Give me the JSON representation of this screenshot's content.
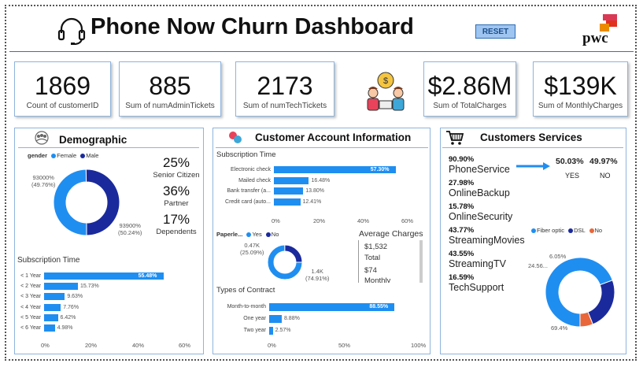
{
  "header": {
    "title": "Phone Now Churn Dashboard",
    "reset_label": "RESET",
    "logo_text": "pwc"
  },
  "kpis": [
    {
      "value": "1869",
      "label": "Count of customerID"
    },
    {
      "value": "885",
      "label": "Sum of numAdminTickets"
    },
    {
      "value": "2173",
      "label": "Sum of numTechTickets"
    },
    {
      "value": "$2.86M",
      "label": "Sum of TotalCharges"
    },
    {
      "value": "$139K",
      "label": "Sum of MonthlyCharges"
    }
  ],
  "demographic": {
    "title": "Demographic",
    "legend_title": "gender",
    "legend": [
      {
        "name": "Female",
        "color": "#1f8ef1"
      },
      {
        "name": "Male",
        "color": "#1a2a9c"
      }
    ],
    "donut_labels": {
      "left_top": "93000%",
      "left_bottom": "(49.76%)",
      "right_top": "93900%",
      "right_bottom": "(50.24%)"
    },
    "stats": [
      {
        "value": "25%",
        "label": "Senior Citizen"
      },
      {
        "value": "36%",
        "label": "Partner"
      },
      {
        "value": "17%",
        "label": "Dependents"
      }
    ],
    "sub_title": "Subscription Time",
    "axis_ticks": [
      "0%",
      "20%",
      "40%",
      "60%"
    ]
  },
  "account": {
    "title": "Customer Account Information",
    "sub_title": "Subscription Time",
    "axis_ticks": [
      "0%",
      "20%",
      "40%",
      "60%"
    ],
    "paperless_title": "Paperle...",
    "paperless_legend": [
      "Yes",
      "No"
    ],
    "paperless_labels": {
      "top": "0.47K",
      "top_pct": "(25.09%)",
      "bottom": "1.4K",
      "bottom_pct": "(74.91%)"
    },
    "avg_title": "Average Charges",
    "avg_total_value": "$1,532",
    "avg_total_label": "Total",
    "avg_monthly_value": "$74",
    "avg_monthly_label": "Monthly",
    "contract_title": "Types of Contract",
    "contract_ticks": [
      "0%",
      "50%",
      "100%"
    ]
  },
  "services": {
    "title": "Customers Services",
    "items": [
      {
        "pct": "90.90%",
        "name": "PhoneService"
      },
      {
        "pct": "27.98%",
        "name": "OnlineBackup"
      },
      {
        "pct": "15.78%",
        "name": "OnlineSecurity"
      },
      {
        "pct": "43.77%",
        "name": "StreamingMovies"
      },
      {
        "pct": "43.55%",
        "name": "StreamingTV"
      },
      {
        "pct": "16.59%",
        "name": "TechSupport"
      }
    ],
    "yes_pct": "50.03%",
    "no_pct": "49.97%",
    "yes_label": "YES",
    "no_label": "NO",
    "internet_legend": [
      {
        "name": "Fiber optic",
        "color": "#1f8ef1"
      },
      {
        "name": "DSL",
        "color": "#1a2a9c"
      },
      {
        "name": "No",
        "color": "#e8663a"
      }
    ],
    "donut_labels": {
      "top": "6.05%",
      "left": "24.56...",
      "bottom": "69.4%"
    }
  },
  "chart_data": [
    {
      "type": "pie",
      "title": "gender",
      "categories": [
        "Female",
        "Male"
      ],
      "values": [
        49.76,
        50.24
      ]
    },
    {
      "type": "bar",
      "title": "Subscription Time",
      "categories": [
        "< 1 Year",
        "< 2 Year",
        "< 3 Year",
        "< 4 Year",
        "< 5 Year",
        "< 6 Year"
      ],
      "values": [
        55.48,
        15.73,
        9.63,
        7.76,
        6.42,
        4.98
      ],
      "value_labels": [
        "55.48%",
        "15.73%",
        "9.63%",
        "7.76%",
        "6.42%",
        "4.98%"
      ],
      "xlim": [
        0,
        60
      ]
    },
    {
      "type": "bar",
      "title": "Subscription Time",
      "categories": [
        "Electronic check",
        "Mailed check",
        "Bank transfer (a...",
        "Credit card (auto..."
      ],
      "values": [
        57.3,
        16.48,
        13.8,
        12.41
      ],
      "value_labels": [
        "57.30%",
        "16.48%",
        "13.80%",
        "12.41%"
      ],
      "xlim": [
        0,
        60
      ]
    },
    {
      "type": "pie",
      "title": "Paperle...",
      "categories": [
        "Yes",
        "No"
      ],
      "values": [
        74.91,
        25.09
      ]
    },
    {
      "type": "bar",
      "title": "Types of Contract",
      "categories": [
        "Month-to-month",
        "One year",
        "Two year"
      ],
      "values": [
        88.55,
        8.88,
        2.57
      ],
      "value_labels": [
        "88.55%",
        "8.88%",
        "2.57%"
      ],
      "xlim": [
        0,
        100
      ]
    },
    {
      "type": "pie",
      "categories": [
        "Fiber optic",
        "DSL",
        "No"
      ],
      "values": [
        69.4,
        24.56,
        6.05
      ]
    }
  ]
}
